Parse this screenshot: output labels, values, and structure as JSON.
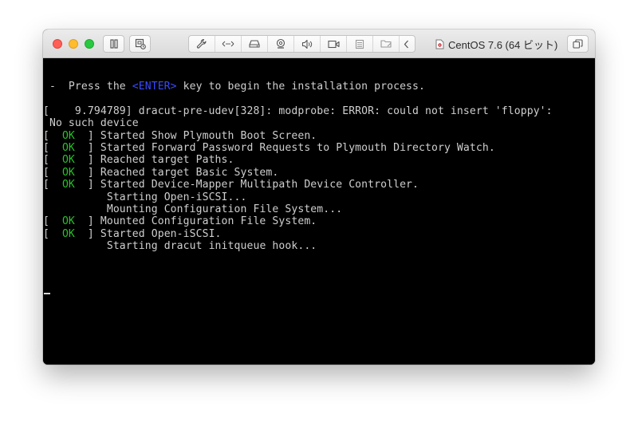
{
  "window": {
    "title": "CentOS 7.6 (64 ビット)"
  },
  "toolbar": {
    "icons": [
      "pause-icon",
      "snapshot-icon",
      "wrench-icon",
      "network-icon",
      "disk-icon",
      "camera-icon",
      "sound-icon",
      "video-icon",
      "printer-icon",
      "shared-folder-icon",
      "chevron-left-icon",
      "fullscreen-icon"
    ]
  },
  "console": {
    "prompt_prefix": " -  Press the ",
    "prompt_key": "<ENTER>",
    "prompt_suffix": " key to begin the installation process.",
    "error_line": "[    9.794789] dracut-pre-udev[328]: modprobe: ERROR: could not insert 'floppy':",
    "error_line_cont": " No such device",
    "ok_label": "OK",
    "boot_lines": [
      {
        "status": true,
        "text": "Started Show Plymouth Boot Screen."
      },
      {
        "status": true,
        "text": "Started Forward Password Requests to Plymouth Directory Watch."
      },
      {
        "status": true,
        "text": "Reached target Paths."
      },
      {
        "status": true,
        "text": "Reached target Basic System."
      },
      {
        "status": true,
        "text": "Started Device-Mapper Multipath Device Controller."
      },
      {
        "status": false,
        "text": "Starting Open-iSCSI..."
      },
      {
        "status": false,
        "text": "Mounting Configuration File System..."
      },
      {
        "status": true,
        "text": "Mounted Configuration File System."
      },
      {
        "status": true,
        "text": "Started Open-iSCSI."
      },
      {
        "status": false,
        "text": "Starting dracut initqueue hook..."
      }
    ]
  },
  "colors": {
    "ok": "#29c229",
    "enter_key": "#3a4aff",
    "console_text": "#cfcfcf",
    "console_bg": "#000000"
  }
}
